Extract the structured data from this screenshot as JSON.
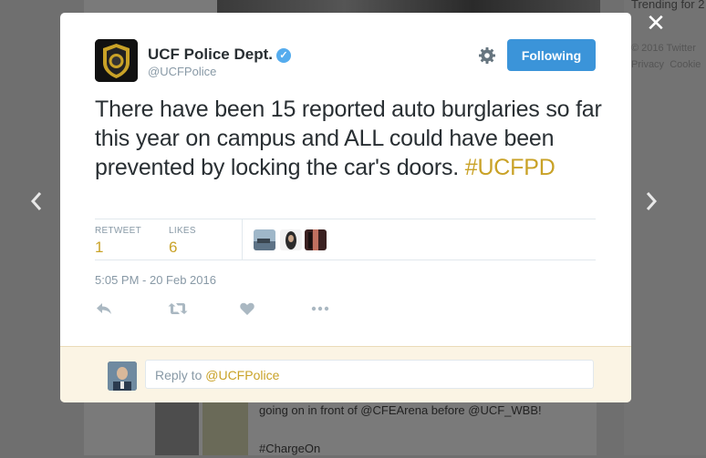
{
  "background": {
    "trending_header": "Trending for 2",
    "footer_links": [
      "© 2016 Twitter",
      "Privacy",
      "Cookie"
    ],
    "tweet_line1": "going on in front of @CFEArena before @UCF_WBB!",
    "tweet_line2": "#ChargeOn"
  },
  "modal": {
    "author": {
      "name": "UCF Police Dept.",
      "handle": "@UCFPolice",
      "verified": true
    },
    "follow_button_label": "Following",
    "tweet": {
      "text": "There have been 15 reported auto burglaries so far this year on campus and ALL could have been prevented by locking the car's doors.",
      "hashtag": "#UCFPD"
    },
    "stats": {
      "retweets_label": "RETWEET",
      "retweets_value": "1",
      "likes_label": "LIKES",
      "likes_value": "6"
    },
    "timestamp": "5:05 PM - 20 Feb 2016",
    "actions": [
      "reply-icon",
      "retweet-icon",
      "like-icon",
      "more-icon"
    ],
    "reply": {
      "prefix": "Reply to ",
      "mention": "@UCFPolice"
    }
  },
  "controls": {
    "close_icon": "close-icon",
    "prev_icon": "chevron-left-icon",
    "next_icon": "chevron-right-icon"
  },
  "colors": {
    "accent": "#c9a227",
    "follow_button": "#3b94d9",
    "verified": "#55acee",
    "reply_area": "#fbf4e4"
  }
}
